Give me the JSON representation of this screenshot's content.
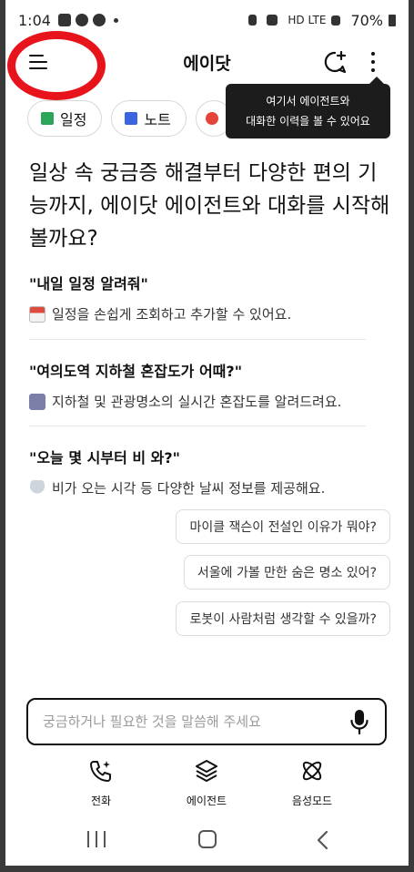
{
  "status_bar": {
    "time": "1:04",
    "network": "HD LTE",
    "battery": "70%"
  },
  "header": {
    "title": "에이닷",
    "menu_icon": "hamburger-menu-icon",
    "new_chat_icon": "chat-plus-icon",
    "more_icon": "more-vertical-icon"
  },
  "tooltip": {
    "line1": "여기서 에이전트와",
    "line2": "대화한 이력을 볼 수 있어요"
  },
  "chips": [
    {
      "label": "일정",
      "icon": "calendar-icon",
      "color": "#2aa55a"
    },
    {
      "label": "노트",
      "icon": "note-icon",
      "color": "#3b64e0"
    },
    {
      "label": "",
      "icon": "record-icon",
      "color": "#e4443a"
    }
  ],
  "headline": "일상 속 궁금증 해결부터 다양한 편의 기능까지, 에이닷 에이전트와 대화를 시작해 볼까요?",
  "suggestions": [
    {
      "question": "\"내일 일정 알려줘\"",
      "desc": "일정을 손쉽게 조회하고 추가할 수 있어요.",
      "icon": "calendar-emoji"
    },
    {
      "question": "\"여의도역 지하철 혼잡도가 어때?\"",
      "desc": "지하철 및 관광명소의 실시간 혼잡도를 알려드려요.",
      "icon": "train-emoji"
    },
    {
      "question": "\"오늘 몇 시부터 비 와?\"",
      "desc": "비가 오는 시각 등 다양한 날씨 정보를 제공해요.",
      "icon": "rain-cloud-emoji"
    }
  ],
  "quick_prompts": [
    "마이클 잭슨이 전설인 이유가 뭐야?",
    "서울에 가볼 만한 숨은 명소 있어?",
    "로봇이 사람처럼 생각할 수 있을까?"
  ],
  "input": {
    "placeholder": "궁금하거나 필요한 것을 말씀해 주세요",
    "value": ""
  },
  "bottom_tabs": [
    {
      "label": "전화",
      "icon": "phone-sparkle-icon"
    },
    {
      "label": "에이전트",
      "icon": "layers-icon"
    },
    {
      "label": "음성모드",
      "icon": "atom-icon"
    }
  ],
  "colors": {
    "annotation_circle": "#e8141c",
    "tooltip_bg": "#1c1c1c"
  }
}
